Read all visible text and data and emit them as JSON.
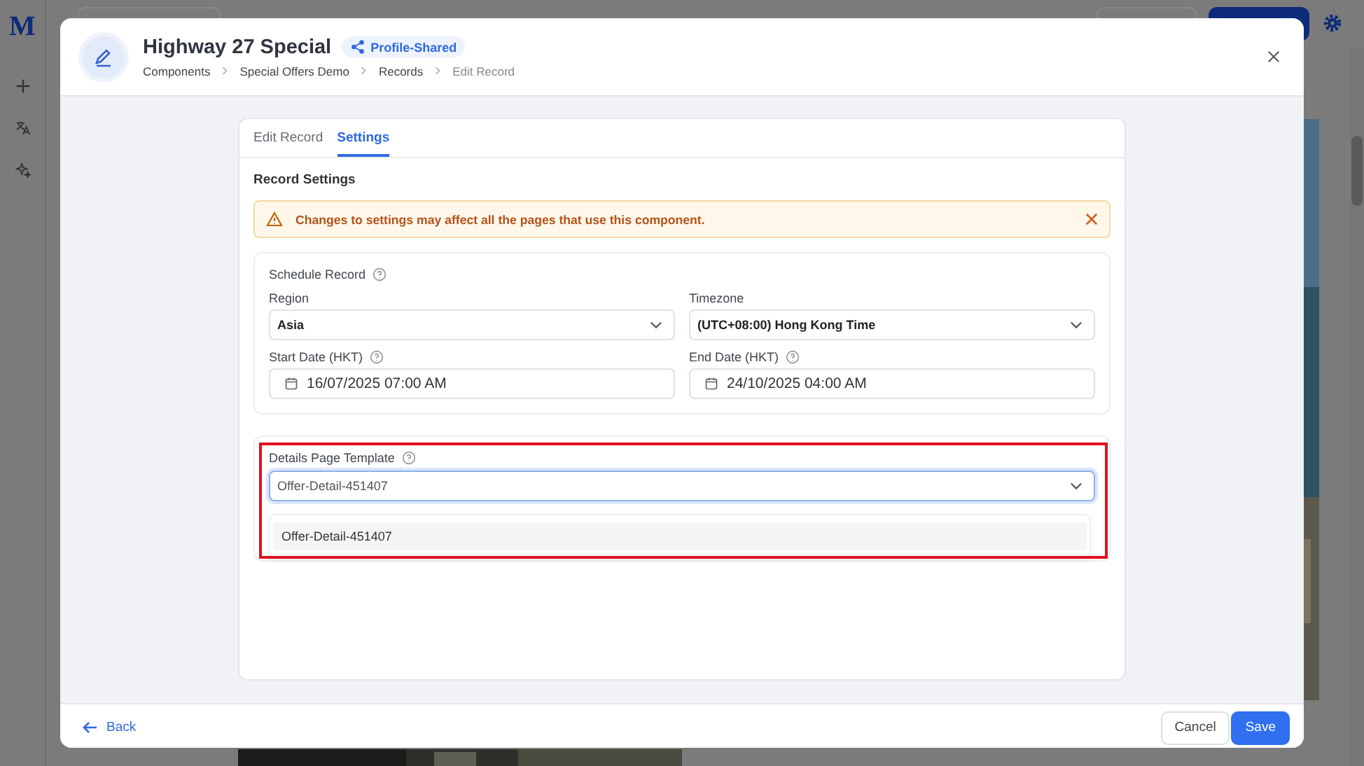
{
  "app": {
    "logo": "M"
  },
  "modal": {
    "title": "Highway 27 Special",
    "badge": "Profile-Shared",
    "breadcrumbs": [
      {
        "label": "Components",
        "current": false
      },
      {
        "label": "Special Offers Demo",
        "current": false
      },
      {
        "label": "Records",
        "current": false
      },
      {
        "label": "Edit Record",
        "current": true
      }
    ],
    "tabs": [
      {
        "label": "Edit Record",
        "selected": false
      },
      {
        "label": "Settings",
        "selected": true
      }
    ],
    "section_title": "Record Settings",
    "alert": {
      "message": "Changes to settings may affect all the pages that use this component."
    },
    "schedule": {
      "title": "Schedule Record",
      "fields": [
        {
          "label": "Region",
          "value": "Asia",
          "kind": "select",
          "help": false
        },
        {
          "label": "Timezone",
          "value": "(UTC+08:00) Hong Kong Time",
          "kind": "select",
          "help": false
        },
        {
          "label": "Start Date (HKT)",
          "value": "16/07/2025 07:00 AM",
          "kind": "date",
          "help": true
        },
        {
          "label": "End Date (HKT)",
          "value": "24/10/2025 04:00 AM",
          "kind": "date",
          "help": true
        }
      ]
    },
    "template": {
      "label": "Details Page Template",
      "value": "Offer-Detail-451407",
      "expanded": true,
      "options": [
        "Offer-Detail-451407"
      ]
    },
    "footer": {
      "back": "Back",
      "cancel": "Cancel",
      "save": "Save"
    }
  }
}
